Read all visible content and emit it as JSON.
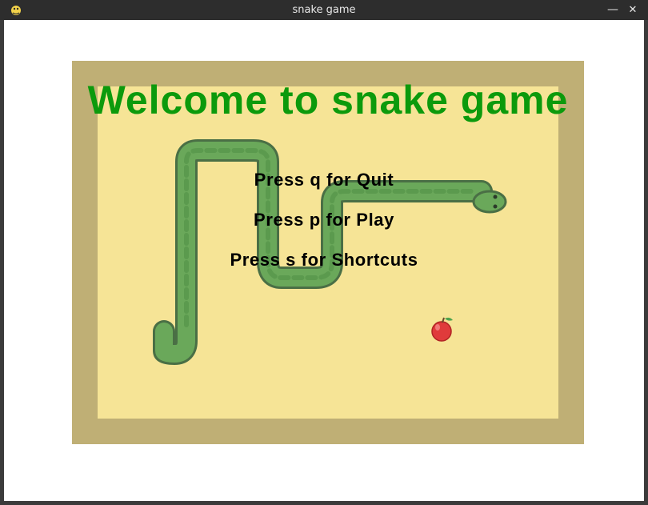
{
  "window": {
    "title": "snake game"
  },
  "game": {
    "welcome_text": "Welcome to snake game",
    "menu": [
      "Press q for Quit",
      "Press p for Play",
      "Press s for Shortcuts"
    ]
  },
  "colors": {
    "border": "#bfaf75",
    "field": "#f6e496",
    "title_text": "#0c9a0c",
    "snake": "#6aa85a",
    "snake_outline": "#4a6f45",
    "apple": "#e03b3b"
  }
}
